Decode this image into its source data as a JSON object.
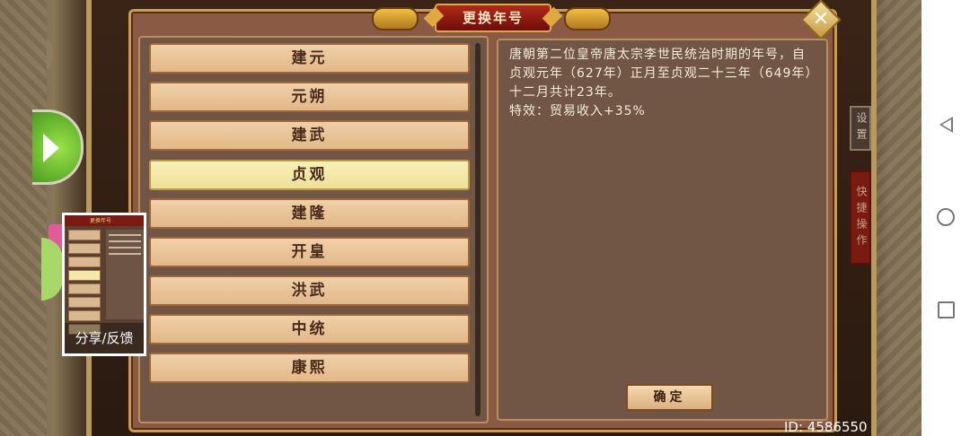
{
  "dialog": {
    "title": "更换年号",
    "era_names": [
      "建元",
      "元朔",
      "建武",
      "贞观",
      "建隆",
      "开皇",
      "洪武",
      "中统",
      "康熙"
    ],
    "selected_index": 3,
    "description": "唐朝第二位皇帝唐太宗李世民统治时期的年号，自贞观元年（627年）正月至贞观二十三年（649年）十二月共计23年。",
    "effect": "特效：贸易收入+35%",
    "confirm_label": "确定",
    "close_icon": "✕"
  },
  "share": {
    "label": "分享/反馈",
    "thumb_title": "更换年号"
  },
  "side_buttons": {
    "settings": "设置",
    "quick_ops": "快捷操作"
  },
  "footer": {
    "id_text": "ID: 4586550"
  }
}
